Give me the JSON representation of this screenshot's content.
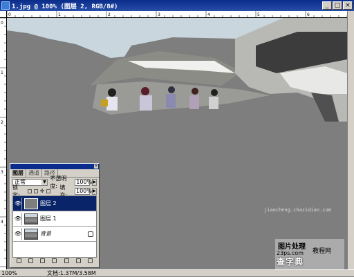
{
  "window": {
    "title": "1.jpg @ 100% (图层 2, RGB/8#)",
    "buttons": {
      "minimize": "_",
      "maximize": "□",
      "close": "×"
    }
  },
  "rulers": {
    "horizontal_ticks": [
      "0",
      "1",
      "2",
      "3",
      "4",
      "5",
      "6"
    ],
    "vertical_ticks": [
      "0",
      "1",
      "2",
      "3",
      "4"
    ]
  },
  "status": {
    "zoom": "100%",
    "doc": "文档:1.37M/3.58M"
  },
  "layers_panel": {
    "tabs": [
      "图层",
      "通道",
      "路径"
    ],
    "blend_mode": "正常",
    "opacity_label": "不透明度:",
    "opacity_value": "100%",
    "lock_label": "锁定:",
    "fill_label": "填充:",
    "fill_value": "100%",
    "layers": [
      {
        "name": "图层 2",
        "active": true
      },
      {
        "name": "图层 1",
        "active": false
      },
      {
        "name": "背景",
        "active": false
      }
    ]
  },
  "watermark": {
    "line1": "图片处理",
    "line2": "教程网",
    "site": "23ps.com",
    "line3": "查字典",
    "url": "jiaocheng.chazidian.com"
  },
  "colors": {
    "titlebar": "#0a2c8a",
    "panel": "#d4d0c8",
    "canvas": "#7e7e7e",
    "selected": "#0a246a"
  }
}
